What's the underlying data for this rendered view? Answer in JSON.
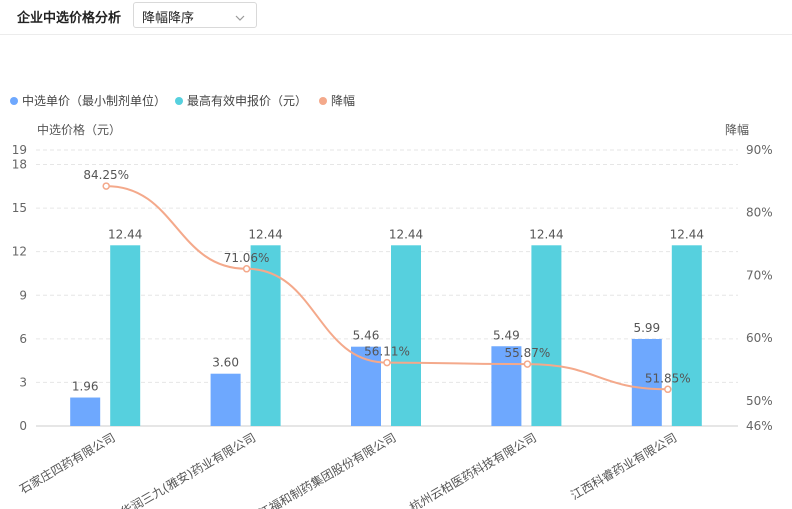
{
  "header": {
    "title": "企业中选价格分析",
    "sort_select": {
      "value": "降幅降序"
    }
  },
  "icons": {
    "select_arrow": "chevron-down-icon"
  },
  "colors": {
    "bar_unit_price": "#6ea8fe",
    "bar_max_price": "#56d0de",
    "line_drop": "#f4a98b",
    "grid": "#e6e6e6",
    "axis_text": "#666666"
  },
  "chart_data": {
    "type": "bar",
    "categories": [
      "石家庄四药有限公司",
      "华润三九(雅安)药业有限公司",
      "黑龙江福和制药集团股份有限公司",
      "杭州云柏医药科技有限公司",
      "江西科睿药业有限公司"
    ],
    "series": [
      {
        "name": "中选单价（最小制剂单位）",
        "type": "bar",
        "values": [
          1.96,
          3.6,
          5.46,
          5.49,
          5.99
        ],
        "labels": [
          "1.96",
          "3.60",
          "5.46",
          "5.49",
          "5.99"
        ]
      },
      {
        "name": "最高有效申报价（元）",
        "type": "bar",
        "values": [
          12.44,
          12.44,
          12.44,
          12.44,
          12.44
        ],
        "labels": [
          "12.44",
          "12.44",
          "12.44",
          "12.44",
          "12.44"
        ]
      },
      {
        "name": "降幅",
        "type": "line",
        "smooth": true,
        "axis": "right",
        "values": [
          84.25,
          71.06,
          56.11,
          55.87,
          51.85
        ],
        "labels": [
          "84.25%",
          "71.06%",
          "56.11%",
          "55.87%",
          "51.85%"
        ]
      }
    ],
    "ylabel": "中选价格（元）",
    "ylabel_right": "降幅",
    "ylim": [
      0,
      19
    ],
    "yticks": [
      "0",
      "3",
      "6",
      "9",
      "12",
      "15",
      "18",
      "19"
    ],
    "ylim_right": [
      46,
      90
    ],
    "yticks_right": [
      "46%",
      "50%",
      "60%",
      "70%",
      "80%",
      "90%"
    ],
    "grid": true,
    "legend_position": "top-left"
  }
}
